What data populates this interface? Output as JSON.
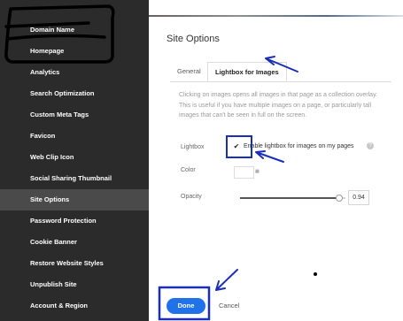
{
  "sidebar": {
    "items": [
      {
        "label": "Domain Name"
      },
      {
        "label": "Homepage"
      },
      {
        "label": "Analytics"
      },
      {
        "label": "Search Optimization"
      },
      {
        "label": "Custom Meta Tags"
      },
      {
        "label": "Favicon"
      },
      {
        "label": "Web Clip Icon"
      },
      {
        "label": "Social Sharing Thumbnail"
      },
      {
        "label": "Site Options",
        "active": true
      },
      {
        "label": "Password Protection"
      },
      {
        "label": "Cookie Banner"
      },
      {
        "label": "Restore Website Styles"
      },
      {
        "label": "Unpublish Site"
      },
      {
        "label": "Account & Region"
      }
    ]
  },
  "panel": {
    "title": "Site Options",
    "tabs": [
      {
        "label": "General",
        "active": false
      },
      {
        "label": "Lightbox for Images",
        "active": true
      }
    ],
    "description": "Clicking on images opens all images in that page as a collection overlay. This is useful if you have multiple images on a page, or particularly tall images that can't be seen in full on the screen.",
    "lightbox": {
      "label": "Lightbox",
      "checked": true,
      "check_glyph": "✔",
      "option_text": "Enable lightbox for images on my pages",
      "info_glyph": "?"
    },
    "color": {
      "label": "Color",
      "value": "#ffffff"
    },
    "opacity": {
      "label": "Opacity",
      "value": "0.94",
      "fraction": 0.94
    }
  },
  "footer": {
    "done_label": "Done",
    "cancel_label": "Cancel"
  },
  "colors": {
    "sidebar_bg": "#2b2b2b",
    "sidebar_active": "#4a4a4a",
    "accent": "#1f72e8",
    "annotation": "#1a2fb8"
  }
}
